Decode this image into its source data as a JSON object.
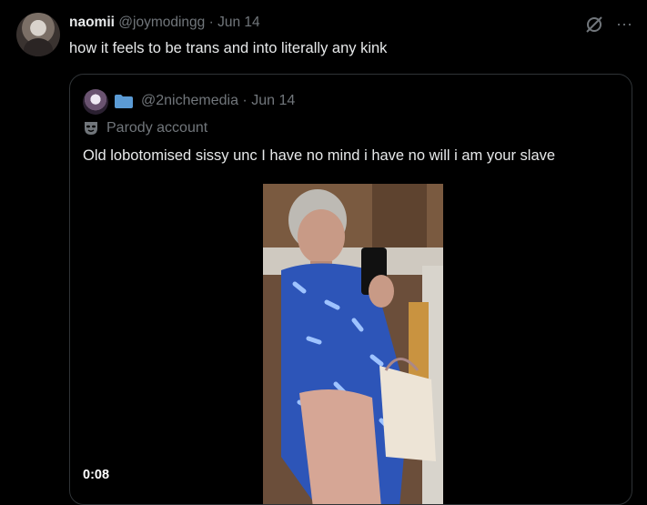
{
  "post": {
    "display_name": "naomii",
    "handle": "@joymodingg",
    "separator": "·",
    "date": "Jun 14",
    "text": "how it feels to be trans and into literally any kink",
    "more_label": "···"
  },
  "quote": {
    "handle": "@2nichemedia",
    "separator": "·",
    "date": "Jun 14",
    "label": "Parody account",
    "text": "Old lobotomised sissy unc I have no mind i have no will i am your slave",
    "video": {
      "duration": "0:08"
    }
  },
  "icons": {
    "avatar": "avatar-photo",
    "grok": "grok-icon",
    "more": "more-icon",
    "folder": "folder-icon",
    "parody": "mask-icon"
  },
  "colors": {
    "background": "#000000",
    "text": "#e7e9ea",
    "muted": "#71767b",
    "border": "#2f3336",
    "folder": "#5b9bd5"
  }
}
